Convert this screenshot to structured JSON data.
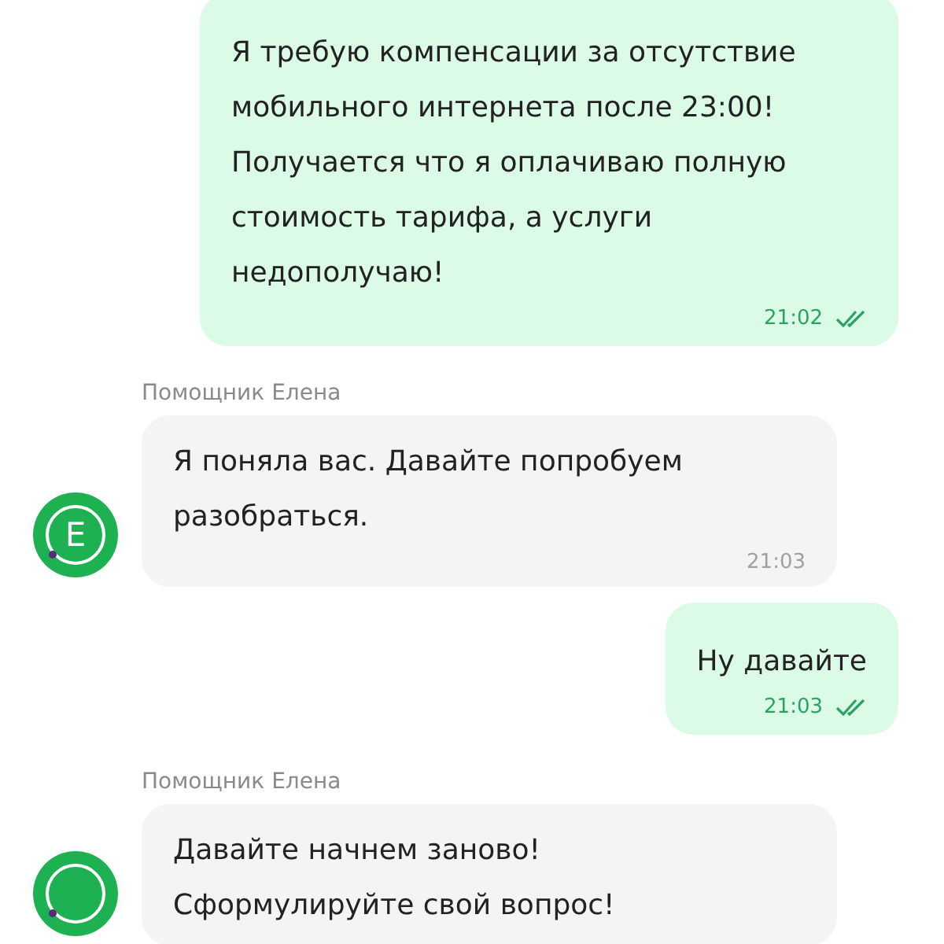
{
  "messages": [
    {
      "kind": "outgoing",
      "text": "Я требую компенсации за отсутствие мобильного интернета после 23:00! Получается что я оплачиваю полную стоимость тарифа, а услуги недополучаю!",
      "time": "21:02",
      "read": true
    },
    {
      "kind": "incoming",
      "sender": "Помощник Елена",
      "avatar": "E",
      "text": "Я поняла вас. Давайте попробуем разобраться.",
      "time": "21:03"
    },
    {
      "kind": "outgoing",
      "text": "Ну давайте",
      "time": "21:03",
      "read": true
    },
    {
      "kind": "incoming",
      "sender": "Помощник Елена",
      "text": "Давайте начнем заново!\nСформулируйте свой вопрос!"
    }
  ]
}
